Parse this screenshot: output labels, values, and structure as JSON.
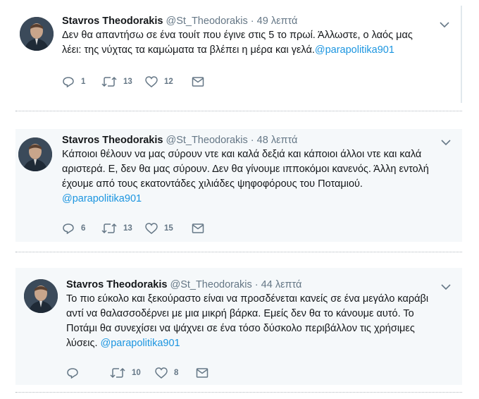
{
  "tweets": [
    {
      "name": "Stavros Theodorakis",
      "handle": "@St_Theodorakis",
      "dot": "·",
      "time": "49 λεπτά",
      "lines": [
        "Δεν θα απαντήσω σε ένα τουίτ που έγινε στις 5 το πρωί. Άλλωστε, ο λαός μας",
        "λέει: της νύχτας τα καμώματα τα βλέπει η μέρα και γελά."
      ],
      "link": "@parapolitika901",
      "replies": "1",
      "retweets": "13",
      "likes": "12"
    },
    {
      "name": "Stavros Theodorakis",
      "handle": "@St_Theodorakis",
      "dot": "·",
      "time": "48 λεπτά",
      "lines": [
        "Κάποιοι θέλουν να μας σύρουν ντε και καλά δεξιά και κάποιοι άλλοι ντε και καλά",
        "αριστερά. Ε, δεν θα μας σύρουν. Δεν θα γίνουμε ιπποκόμοι κανενός. Άλλη εντολή",
        "έχουμε από τους εκατοντάδες χιλιάδες ψηφοφόρους του Ποταμιού."
      ],
      "link": "@parapolitika901",
      "replies": "6",
      "retweets": "13",
      "likes": "15"
    },
    {
      "name": "Stavros Theodorakis",
      "handle": "@St_Theodorakis",
      "dot": "·",
      "time": "44 λεπτά",
      "lines": [
        "Το πιο εύκολο και ξεκούραστο είναι να προσδένεται κανείς σε ένα μεγάλο καράβι",
        "αντί να θαλασσοδέρνει με μια μικρή βάρκα. Εμείς δεν θα το κάνουμε αυτό. Το",
        "Ποτάμι θα συνεχίσει να ψάχνει σε ένα τόσο δύσκολο περιβάλλον τις χρήσιμες",
        "λύσεις."
      ],
      "link": "@parapolitika901",
      "replies": "",
      "retweets": "10",
      "likes": "8"
    }
  ],
  "icons": {
    "reply": "reply-icon",
    "retweet": "retweet-icon",
    "like": "heart-icon",
    "dm": "envelope-icon",
    "more": "chevron-down-icon"
  },
  "colors": {
    "link": "#1b95e0",
    "muted": "#657786",
    "tweet_bg": "#f5f8fa"
  }
}
